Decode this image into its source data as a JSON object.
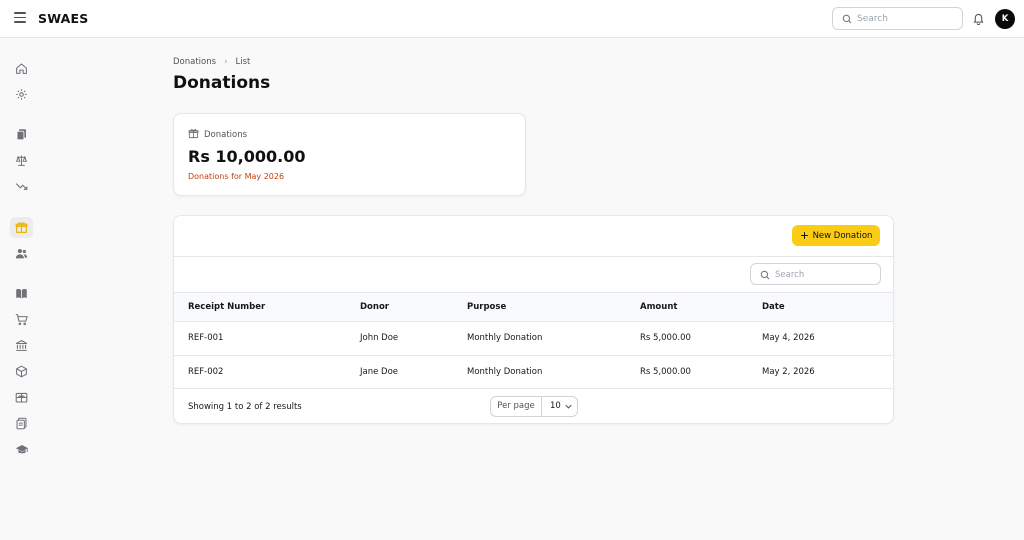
{
  "app": {
    "brand": "SWAES",
    "search_placeholder": "Search",
    "avatar_initial": "K",
    "accent_color": "#facc15"
  },
  "sidebar": {
    "items": [
      {
        "name": "home",
        "icon": "home-icon",
        "active": false
      },
      {
        "name": "settings",
        "icon": "gear-icon",
        "active": false
      },
      {
        "name": "documents",
        "icon": "documents-icon",
        "active": false
      },
      {
        "name": "balance",
        "icon": "scale-icon",
        "active": false
      },
      {
        "name": "trending",
        "icon": "trending-down-icon",
        "active": false
      },
      {
        "name": "donations",
        "icon": "gift-icon",
        "active": true
      },
      {
        "name": "users",
        "icon": "users-icon",
        "active": false
      },
      {
        "name": "books",
        "icon": "book-icon",
        "active": false
      },
      {
        "name": "cart",
        "icon": "cart-icon",
        "active": false
      },
      {
        "name": "bank",
        "icon": "bank-icon",
        "active": false
      },
      {
        "name": "inventory",
        "icon": "cube-icon",
        "active": false
      },
      {
        "name": "scholarship",
        "icon": "gift-card-icon",
        "active": false
      },
      {
        "name": "records",
        "icon": "clipboard-icon",
        "active": false
      },
      {
        "name": "education",
        "icon": "graduation-cap-icon",
        "active": false
      }
    ]
  },
  "breadcrumb": {
    "parent": "Donations",
    "current": "List"
  },
  "page": {
    "title": "Donations"
  },
  "stat": {
    "label": "Donations",
    "value": "Rs 10,000.00",
    "description": "Donations for May 2026"
  },
  "table": {
    "new_button": "New Donation",
    "search_placeholder": "Search",
    "columns": [
      "Receipt Number",
      "Donor",
      "Purpose",
      "Amount",
      "Date"
    ],
    "rows": [
      [
        "REF-001",
        "John Doe",
        "Monthly Donation",
        "Rs 5,000.00",
        "May 4, 2026"
      ],
      [
        "REF-002",
        "Jane Doe",
        "Monthly Donation",
        "Rs 5,000.00",
        "May 2, 2026"
      ]
    ],
    "footer": {
      "showing": "Showing 1 to 2 of 2 results",
      "per_page_label": "Per page",
      "per_page_value": "10"
    }
  }
}
